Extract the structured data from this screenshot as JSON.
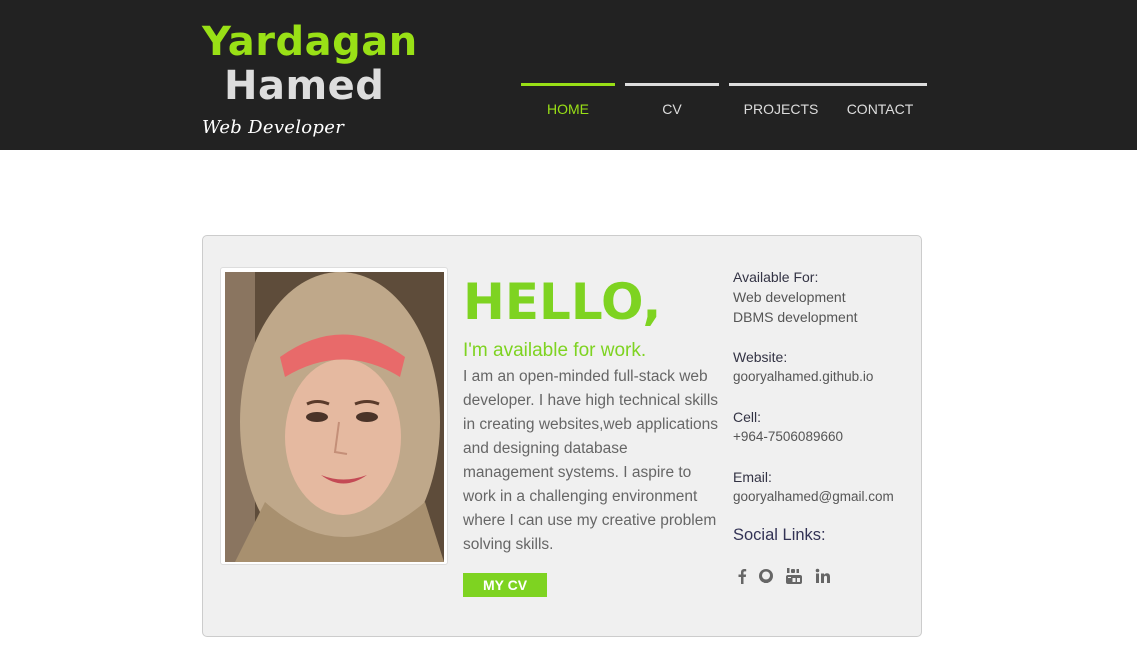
{
  "logo": {
    "first_name": "Yardagan",
    "last_name": "Hamed",
    "tagline": "Web Developer"
  },
  "nav": {
    "items": [
      {
        "label": "HOME",
        "active": true
      },
      {
        "label": "CV",
        "active": false
      },
      {
        "label": "PROJECTS",
        "active": false
      },
      {
        "label": "CONTACT",
        "active": false
      }
    ]
  },
  "intro": {
    "greeting": "HELLO,",
    "subtitle": "I'm available for work.",
    "bio": "I am an open-minded full-stack web developer. I have high technical skills in creating websites,web applications and designing database management systems. I aspire to work in a challenging environment where I can use my creative problem solving skills.",
    "cv_button": "MY CV"
  },
  "contact": {
    "available_label": "Available For:",
    "available_items": [
      "Web development",
      "DBMS development"
    ],
    "website_label": "Website:",
    "website": "gooryalhamed.github.io",
    "cell_label": "Cell:",
    "cell": "+964-7506089660",
    "email_label": "Email:",
    "email": "gooryalhamed@gmail.com",
    "social_title": "Social Links:",
    "social_icons": [
      "facebook-icon",
      "github-icon",
      "youtube-icon",
      "linkedin-icon"
    ]
  },
  "colors": {
    "accent": "#7ed321",
    "header_bg": "#222222",
    "card_bg": "#f0f0f0"
  }
}
